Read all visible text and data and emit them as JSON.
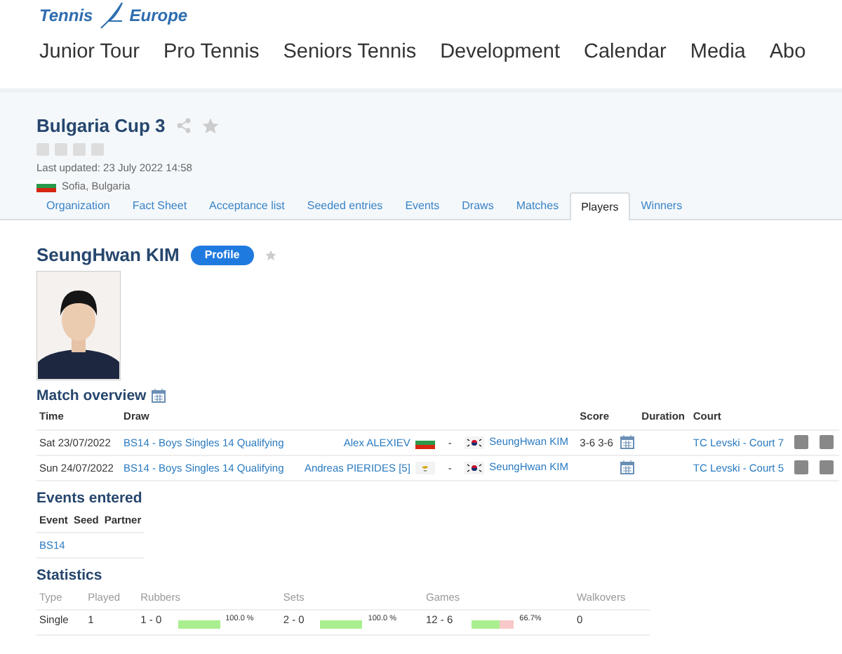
{
  "logo": {
    "left": "Tennis",
    "right": "Europe"
  },
  "main_nav": [
    "Junior Tour",
    "Pro Tennis",
    "Seniors Tennis",
    "Development",
    "Calendar",
    "Media",
    "Abo"
  ],
  "tournament": {
    "title": "Bulgaria Cup 3",
    "last_updated": "Last updated: 23 July 2022 14:58",
    "location": "Sofia, Bulgaria",
    "flag": {
      "kind": "bg"
    }
  },
  "tabs": [
    {
      "label": "Organization",
      "selected": false
    },
    {
      "label": "Fact Sheet",
      "selected": false
    },
    {
      "label": "Acceptance list",
      "selected": false
    },
    {
      "label": "Seeded entries",
      "selected": false
    },
    {
      "label": "Events",
      "selected": false
    },
    {
      "label": "Draws",
      "selected": false
    },
    {
      "label": "Matches",
      "selected": false
    },
    {
      "label": "Players",
      "selected": true
    },
    {
      "label": "Winners",
      "selected": false
    }
  ],
  "player": {
    "name": "SeungHwan KIM",
    "profile_button": "Profile",
    "favourite": false
  },
  "match_overview": {
    "title": "Match overview",
    "columns": [
      "Time",
      "Draw",
      "Score",
      "Duration",
      "Court"
    ],
    "rows": [
      {
        "time": "Sat 23/07/2022",
        "draw": "BS14 - Boys Singles 14 Qualifying",
        "player1": {
          "name": "Alex ALEXIEV",
          "flag": {
            "kind": "bg"
          }
        },
        "separator": "-",
        "player2": {
          "name": "SeungHwan KIM",
          "flag": {
            "kind": "kr"
          }
        },
        "score": "3-6 3-6",
        "court": "TC Levski - Court 7"
      },
      {
        "time": "Sun 24/07/2022",
        "draw": "BS14 - Boys Singles 14 Qualifying",
        "player1": {
          "name": "Andreas PIERIDES [5]",
          "flag": {
            "kind": "cy"
          }
        },
        "separator": "-",
        "player2": {
          "name": "SeungHwan KIM",
          "flag": {
            "kind": "kr"
          }
        },
        "court": "TC Levski - Court 5"
      }
    ]
  },
  "events_entered": {
    "title": "Events entered",
    "columns": [
      "Event",
      "Seed",
      "Partner"
    ],
    "rows": [
      {
        "event": "BS14"
      }
    ]
  },
  "statistics": {
    "title": "Statistics",
    "columns": [
      "Type",
      "Played",
      "Rubbers",
      "Sets",
      "Games",
      "Walkovers"
    ],
    "rows": [
      {
        "type": "Single",
        "played": "1",
        "rubbers": {
          "score": "1 - 0",
          "ratio": {
            "level": 1.0
          },
          "percent": "100.0 %"
        },
        "sets": {
          "score": "2 - 0",
          "ratio": {
            "level": 1.0
          },
          "percent": "100.0 %"
        },
        "games": {
          "score": "12 - 6",
          "ratio": {
            "level": 0.667
          },
          "percent": "66.7%"
        },
        "walkovers": "0"
      }
    ]
  }
}
